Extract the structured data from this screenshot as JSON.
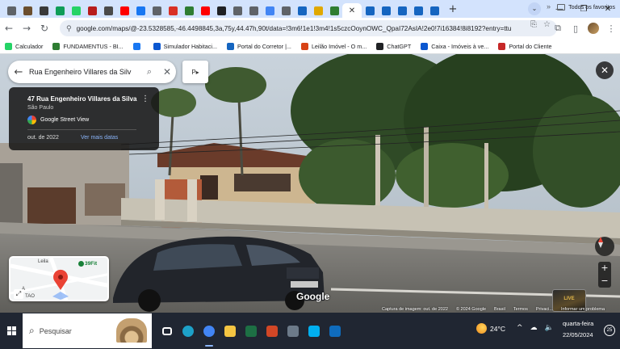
{
  "browser": {
    "url": "google.com/maps/@-23.5328585,-46.4498845,3a,75y,44.47h,90t/data=!3m6!1e1!3m4!1s5czcOoynOWC_QpaI72AsIA!2e0!7i16384!8i8192?entry=ttu",
    "tab_list_label": "⌄",
    "new_tab": "+",
    "window_controls": {
      "minimize": "—",
      "restore": "❐",
      "close": "✕"
    },
    "active_tab_close": "✕",
    "tab_colors": [
      "#5f6368",
      "#6b4e2e",
      "#3a3a3a",
      "#0f9d58",
      "#25d366",
      "#b71c1c",
      "#4a4a4a",
      "#ff0000",
      "#1877f2",
      "#5f6368",
      "#d93025",
      "#2e7d32",
      "#ff0000",
      "#202124",
      "#5f6368",
      "#5f6368",
      "#4285f4",
      "#5f6368",
      "#1565c0",
      "#e0a800",
      "#2e7d32",
      "#1565c0",
      "#1565c0",
      "#1565c0",
      "#1565c0",
      "#1565c0"
    ]
  },
  "bookmarks": {
    "items": [
      {
        "label": "Calculador",
        "color": "#25d366"
      },
      {
        "label": "FUNDAMENTUS - BI...",
        "color": "#2e7d32"
      },
      {
        "label": "",
        "color": "#1877f2"
      },
      {
        "label": "Simulador Habitaci...",
        "color": "#0b57d0"
      },
      {
        "label": "Portal do Corretor |...",
        "color": "#1565c0"
      },
      {
        "label": "Leilão Imóvel - O m...",
        "color": "#d84315"
      },
      {
        "label": "ChatGPT",
        "color": "#202124"
      },
      {
        "label": "Caixa - Imóveis à ve...",
        "color": "#0b57d0"
      },
      {
        "label": "Portal do Cliente",
        "color": "#c62828"
      }
    ],
    "more": "»",
    "all": "Todos os favoritos"
  },
  "streetview": {
    "search_query": "Rua Engenheiro Villares da Silv",
    "pano_label": "P▸",
    "info": {
      "address": "47 Rua Engenheiro Villares da Silva",
      "city": "São Paulo",
      "provider": "Google Street View",
      "date": "out. de 2022",
      "more_dates": "Ver mais datas"
    },
    "minimap": {
      "poi": "39Fit",
      "street1": "Leila",
      "street2": "A",
      "street3": "TAO"
    },
    "zoom_in": "+",
    "zoom_out": "−",
    "thumb_label": "LIVE",
    "google_logo": "Google",
    "footer": {
      "capture": "Captura de imagem: out. de 2022",
      "copyright": "© 2024 Google",
      "country": "Brasil",
      "terms": "Termos",
      "privacy": "Privaci...",
      "report": "Informar um problema"
    }
  },
  "taskbar": {
    "search_label": "Pesquisar",
    "weather": "24°C",
    "day": "quarta-feira",
    "date": "22/05/2024",
    "notifications": "25",
    "tray_icons": [
      "^",
      "☁",
      "🔈"
    ],
    "apps": [
      {
        "name": "task-view-icon",
        "color": "#ffffff"
      },
      {
        "name": "edge-icon",
        "color": "#1da1c8"
      },
      {
        "name": "chrome-icon",
        "color": "#4285f4"
      },
      {
        "name": "file-explorer-icon",
        "color": "#f4c542"
      },
      {
        "name": "excel-icon",
        "color": "#1d7044"
      },
      {
        "name": "powerpoint-icon",
        "color": "#d24726"
      },
      {
        "name": "calculator-icon",
        "color": "#6c7a89"
      },
      {
        "name": "skype-icon",
        "color": "#00aff0"
      },
      {
        "name": "outlook-icon",
        "color": "#0f6cbd"
      }
    ]
  }
}
